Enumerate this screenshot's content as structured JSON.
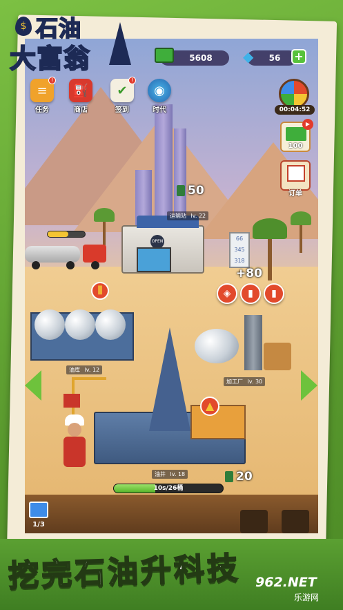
{
  "logo": {
    "line1": "石油",
    "line2": "大富翁"
  },
  "currency": {
    "cash": "5608",
    "gems": "56",
    "add_label": "+"
  },
  "top_icons": [
    {
      "name": "task",
      "label": "任务",
      "icon": "clipboard-icon",
      "badge": "!"
    },
    {
      "name": "shop",
      "label": "商店",
      "icon": "fuel-pump-icon"
    },
    {
      "name": "signin",
      "label": "签到",
      "icon": "calendar-check-icon",
      "badge": "!"
    },
    {
      "name": "era",
      "label": "时代",
      "icon": "globe-icon"
    }
  ],
  "right_panel": {
    "timer": "00:04:52",
    "cash_reward": "100",
    "orders_label": "订单"
  },
  "transport": {
    "label": "运输站",
    "level": "lv. 22",
    "value": "50"
  },
  "refinery": {
    "label": "加工厂",
    "level": "lv. 30",
    "value": "+80"
  },
  "storage": {
    "label": "油库",
    "level": "lv. 12"
  },
  "well": {
    "label": "油井",
    "level": "lv. 18",
    "value": "20",
    "progress_text": "10s/26桶",
    "progress": 0.38
  },
  "gift": {
    "count": "1/3"
  },
  "sign_text": {
    "s1": "66",
    "s2": "345",
    "s3": "318"
  },
  "slogan": "挖完石油升科技",
  "watermark": {
    "main": "962.NET",
    "sub": "乐游网"
  },
  "colors": {
    "accent_green": "#5ba032",
    "cash_green": "#3fae3b",
    "gem_blue": "#3fb2e8",
    "badge_red": "#e23b2c"
  }
}
